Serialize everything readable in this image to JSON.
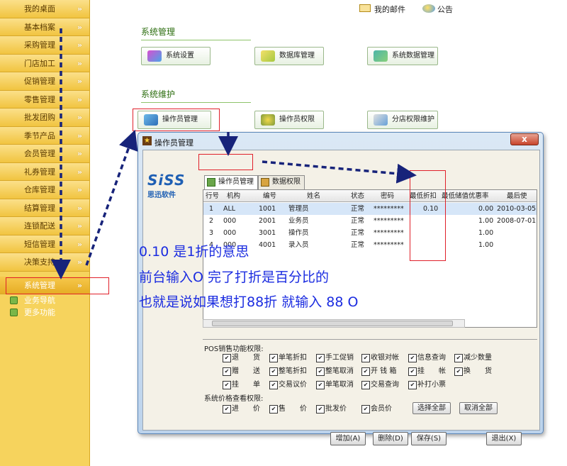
{
  "sidebar": {
    "items": [
      {
        "label": "我的桌面"
      },
      {
        "label": "基本档案"
      },
      {
        "label": "采购管理"
      },
      {
        "label": "门店加工"
      },
      {
        "label": "促销管理"
      },
      {
        "label": "零售管理"
      },
      {
        "label": "批发团购"
      },
      {
        "label": "季节产品"
      },
      {
        "label": "会员管理"
      },
      {
        "label": "礼券管理"
      },
      {
        "label": "仓库管理"
      },
      {
        "label": "结算管理"
      },
      {
        "label": "连锁配送"
      },
      {
        "label": "短信管理"
      },
      {
        "label": "决策支持"
      },
      {
        "label": "系统管理"
      }
    ],
    "sub_items": [
      {
        "label": "业务导航"
      },
      {
        "label": "更多功能"
      }
    ]
  },
  "topbar": {
    "mail_label": "我的邮件",
    "notice_label": "公告"
  },
  "system_mgmt": {
    "title": "系统管理",
    "buttons": [
      "系统设置",
      "数据库管理",
      "系统数据管理"
    ]
  },
  "system_maint": {
    "title": "系统维护",
    "buttons": [
      "操作员管理",
      "操作员权限",
      "分店权限维护"
    ]
  },
  "dialog": {
    "title": "操作员管理",
    "close": "x",
    "logo_main": "SiSS",
    "logo_sub": "思迅软件",
    "tabs": [
      "操作员管理",
      "数据权限"
    ],
    "table": {
      "headers": [
        "行号",
        "机构",
        "编号",
        "姓名",
        "状态",
        "密码",
        "最低折扣",
        "最低储值优惠率",
        "最后使"
      ],
      "rows": [
        [
          "1",
          "ALL",
          "1001",
          "管理员",
          "正常",
          "*********",
          "0.10",
          "0.00",
          "2010-03-05"
        ],
        [
          "2",
          "000",
          "2001",
          "业务员",
          "正常",
          "*********",
          "",
          "1.00",
          "2008-07-01"
        ],
        [
          "3",
          "000",
          "3001",
          "操作员",
          "正常",
          "*********",
          "",
          "1.00",
          ""
        ],
        [
          "4",
          "000",
          "4001",
          "录入员",
          "正常",
          "*********",
          "",
          "1.00",
          ""
        ]
      ]
    },
    "pos_perm_title": "POS销售功能权限:",
    "pos_perms": [
      [
        "退　　货",
        "单笔折扣",
        "手工促销",
        "收银对帐",
        "信息查询",
        "减少数量"
      ],
      [
        "赠　　送",
        "整笔折扣",
        "整笔取消",
        "开 钱 箱",
        "挂　　帐",
        "换　　货"
      ],
      [
        "挂　　单",
        "交易议价",
        "单笔取消",
        "交易查询",
        "补打小票"
      ]
    ],
    "price_perm_title": "系统价格查看权限:",
    "price_perms": [
      "进　　价",
      "售　　价",
      "批发价",
      "会员价"
    ],
    "select_all": "选择全部",
    "cancel_all": "取消全部",
    "footer_buttons": [
      "增加(A)",
      "删除(D)",
      "保存(S)",
      "退出(X)"
    ]
  },
  "annotation": {
    "line1": "0.10 是1折的意思",
    "line2": "前台输入O 完了打折是百分比的",
    "line3": "也就是说如果想打88折 就输入 88 O"
  },
  "colors": {
    "sidebar": "#f6d35d",
    "annotation": "#1b2ce0",
    "highlight": "#e0202a",
    "arrow": "#17237a"
  }
}
